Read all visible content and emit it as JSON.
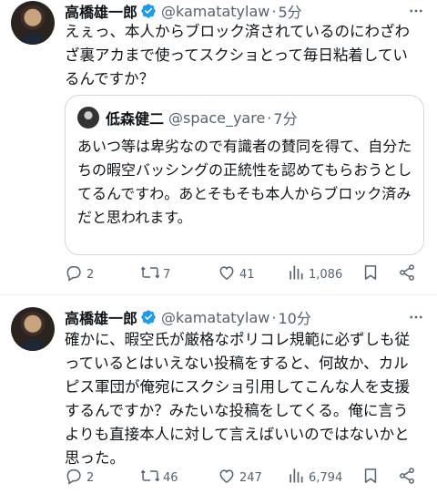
{
  "tweets": [
    {
      "author": "高橋雄一郎",
      "handle": "@kamatatylaw",
      "separator": "·",
      "time": "5分",
      "text": "えぇっ、本人からブロック済されているのにわざわざ裏アカまで使ってスクショとって毎日粘着しているんですか？",
      "quote": {
        "author": "低森健二",
        "handle": "@space_yare",
        "separator": "·",
        "time": "7分",
        "text": "あいつ等は卑劣なので有識者の賛同を得て、自分たちの暇空バッシングの正統性を認めてもらおうとしてるんですわ。あとそもそも本人からブロック済みだと思われます。"
      },
      "stats": {
        "replies": "2",
        "retweets": "7",
        "likes": "41",
        "views": "1,086"
      }
    },
    {
      "author": "高橋雄一郎",
      "handle": "@kamatatylaw",
      "separator": "·",
      "time": "10分",
      "text": "確かに、暇空氏が厳格なポリコレ規範に必ずしも従っているとはいえない投稿をすると、何故か、カルピス軍団が俺宛にスクショ引用してこんな人を支援するんですか？みたいな投稿をしてくる。俺に言うよりも直接本人に対して言えばいいのではないかと思った。",
      "stats": {
        "replies": "2",
        "retweets": "46",
        "likes": "247",
        "views": "6,794"
      }
    }
  ],
  "icons": {
    "verified": "verified-badge-icon",
    "more": "more-dots-icon",
    "reply": "reply-icon",
    "retweet": "retweet-icon",
    "like": "heart-icon",
    "views": "views-chart-icon",
    "bookmark": "bookmark-icon",
    "share": "share-icon"
  },
  "colors": {
    "text": "#0f1419",
    "secondary": "#536471",
    "verified": "#1d9bf0",
    "border": "#cfd9de"
  }
}
